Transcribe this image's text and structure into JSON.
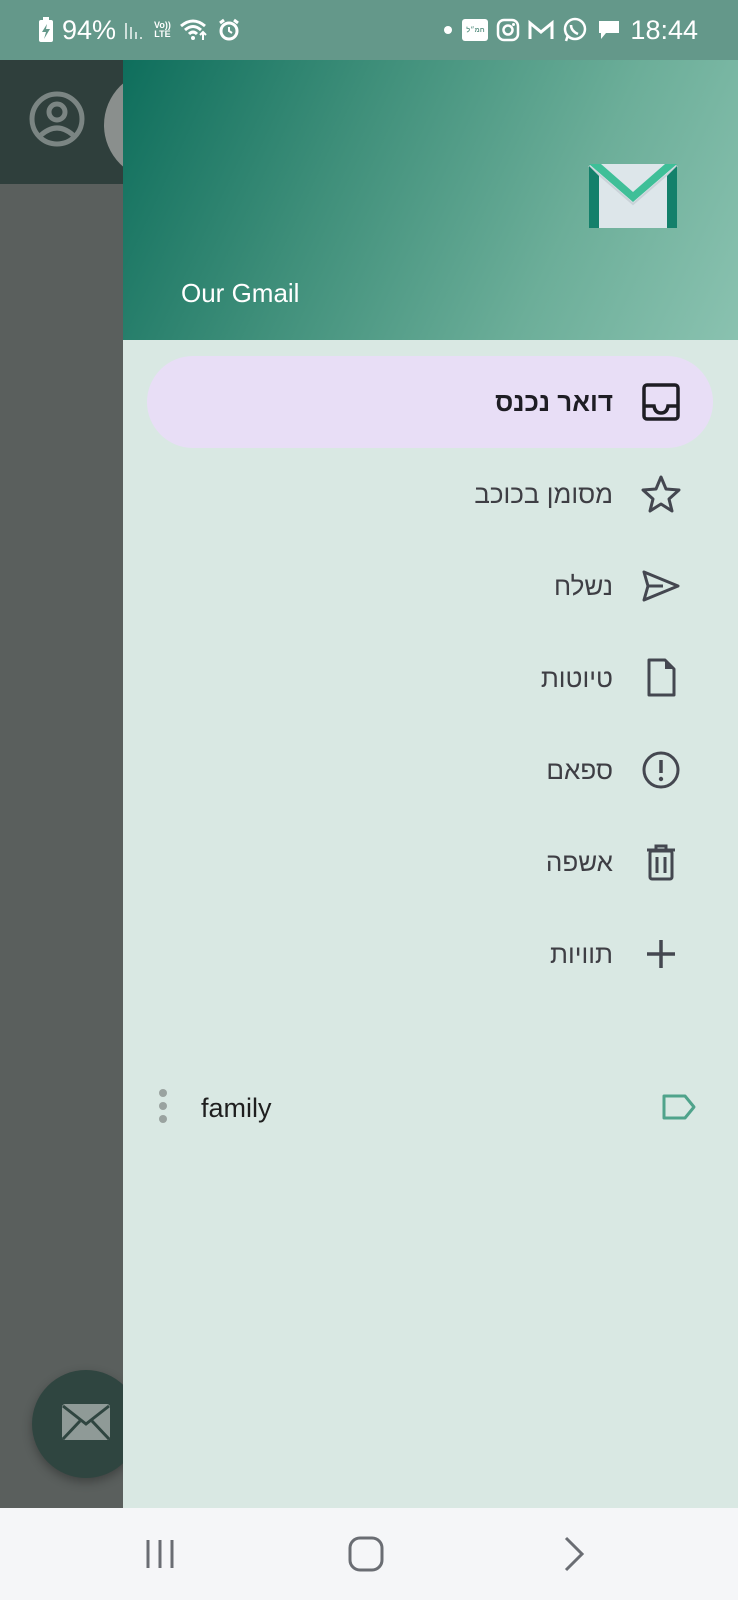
{
  "status_bar": {
    "battery_percent": "94%",
    "time": "18:44",
    "volte_label_top": "Vo))",
    "volte_label_bottom": "LTE",
    "news_badge": "חמ״ל",
    "icons_left": [
      "battery-charging-icon",
      "signal-icon",
      "volte-icon",
      "wifi-icon",
      "alarm-icon"
    ],
    "icons_right": [
      "dot-icon",
      "news-app-icon",
      "instagram-icon",
      "gmail-icon",
      "whatsapp-icon",
      "chat-icon"
    ]
  },
  "drawer": {
    "header_title": "Our Gmail",
    "logo_icon": "mail-envelope-icon",
    "items": [
      {
        "label": "דואר נכנס",
        "icon": "inbox-icon",
        "active": true
      },
      {
        "label": "מסומן בכוכב",
        "icon": "star-icon",
        "active": false
      },
      {
        "label": "נשלח",
        "icon": "send-icon",
        "active": false
      },
      {
        "label": "טיוטות",
        "icon": "draft-icon",
        "active": false
      },
      {
        "label": "ספאם",
        "icon": "spam-icon",
        "active": false
      },
      {
        "label": "אשפה",
        "icon": "trash-icon",
        "active": false
      },
      {
        "label": "תוויות",
        "icon": "add-icon",
        "active": false
      }
    ],
    "labels": [
      {
        "label": "family",
        "icon": "label-tag-icon"
      }
    ]
  },
  "colors": {
    "status_bar": "#64988a",
    "drawer_bg": "#d9e8e3",
    "active_item_bg": "#e8def6",
    "label_tag": "#4fa38b"
  },
  "nav_bar": {
    "buttons": [
      "recent-apps-icon",
      "home-icon",
      "back-icon"
    ]
  }
}
